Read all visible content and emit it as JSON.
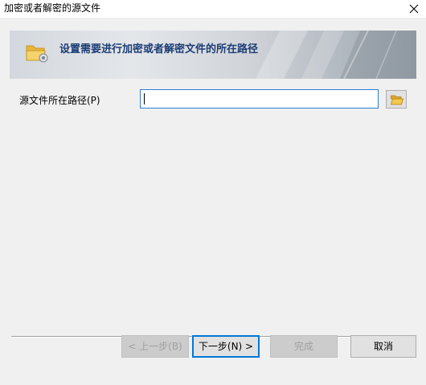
{
  "window": {
    "title": "加密或者解密的源文件"
  },
  "banner": {
    "heading": "设置需要进行加密或者解密文件的所在路径",
    "icon": "folder-gear-icon"
  },
  "form": {
    "path_label": "源文件所在路径(P)",
    "path_value": "",
    "browse_icon": "folder-open-icon"
  },
  "buttons": {
    "back": "< 上一步(B)",
    "next": "下一步(N) >",
    "finish": "完成",
    "cancel": "取消"
  },
  "colors": {
    "accent": "#0078d7",
    "banner_text": "#1d3d75",
    "folder": "#f3c94e"
  }
}
